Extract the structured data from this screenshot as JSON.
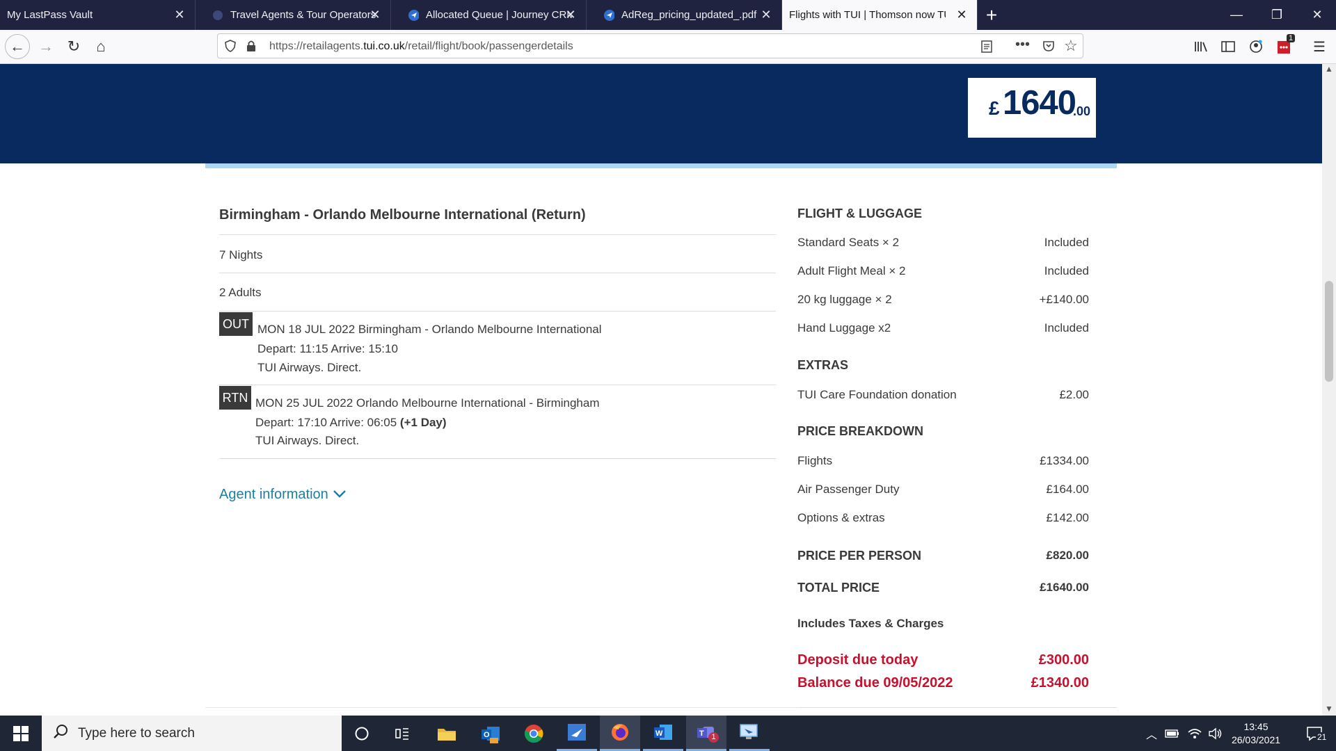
{
  "browser": {
    "tabs": [
      {
        "title": "My LastPass Vault",
        "active": false,
        "icon": "lastpass-icon"
      },
      {
        "title": "Travel Agents & Tour Operators",
        "active": false,
        "icon": "globe-icon"
      },
      {
        "title": "Allocated Queue | Journey CRM",
        "active": false,
        "icon": "crm-icon"
      },
      {
        "title": "AdReg_pricing_updated_.pdf",
        "active": false,
        "icon": "crm-icon"
      },
      {
        "title": "Flights with TUI | Thomson now TUI",
        "active": true,
        "icon": "tui-icon"
      }
    ],
    "url_prefix": "https://retailagents.",
    "url_domain": "tui.co.uk",
    "url_path": "/retail/flight/book/passengerdetails",
    "extension_badge": "1"
  },
  "header": {
    "price_symbol": "£",
    "price_main": "1640",
    "price_decimal": ".00"
  },
  "summary": {
    "title": "Birmingham - Orlando Melbourne International (Return)",
    "nights": "7 Nights",
    "passengers": "2 Adults",
    "outbound": {
      "badge": "OUT",
      "route": "MON 18 JUL 2022 Birmingham  - Orlando Melbourne International",
      "times": "Depart: 11:15 Arrive: 15:10",
      "carrier": "TUI Airways. Direct."
    },
    "inbound": {
      "badge": "RTN",
      "route": "MON 25 JUL 2022 Orlando Melbourne International - Birmingham",
      "times": "Depart: 17:10 Arrive: 06:05",
      "next_day": "(+1 Day)",
      "carrier": "TUI Airways. Direct."
    },
    "agent_link": "Agent information"
  },
  "price_panel": {
    "flight_luggage_heading": "FLIGHT & LUGGAGE",
    "flight_luggage": [
      {
        "label": "Standard Seats × 2",
        "value": "Included"
      },
      {
        "label": "Adult Flight Meal × 2",
        "value": "Included"
      },
      {
        "label": "20 kg luggage × 2",
        "value": "+£140.00"
      },
      {
        "label": "Hand Luggage x2",
        "value": "Included"
      }
    ],
    "extras_heading": "EXTRAS",
    "extras": [
      {
        "label": "TUI Care Foundation donation",
        "value": "£2.00"
      }
    ],
    "breakdown_heading": "PRICE BREAKDOWN",
    "breakdown": [
      {
        "label": "Flights",
        "value": "£1334.00"
      },
      {
        "label": "Air Passenger Duty",
        "value": "£164.00"
      },
      {
        "label": "Options & extras",
        "value": "£142.00"
      }
    ],
    "per_person_label": "PRICE PER PERSON",
    "per_person_value": "£820.00",
    "total_label": "TOTAL PRICE",
    "total_value": "£1640.00",
    "taxes_note": "Includes Taxes & Charges",
    "deposit_label": "Deposit due today",
    "deposit_value": "£300.00",
    "balance_label": "Balance due 09/05/2022",
    "balance_value": "£1340.00"
  },
  "taskbar": {
    "search_placeholder": "Type here to search",
    "time": "13:45",
    "date": "26/03/2021",
    "notification_count": "21",
    "teams_badge": "1"
  },
  "colors": {
    "hero": "#092a5e",
    "accent_link": "#1b7fa3",
    "due_red": "#c8102e"
  }
}
